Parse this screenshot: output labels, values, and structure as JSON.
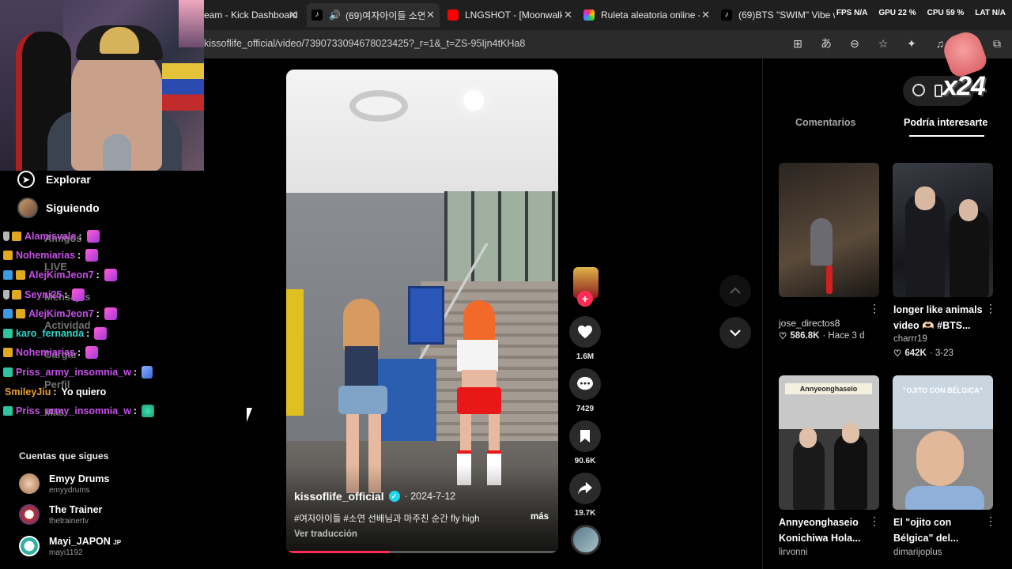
{
  "tabs": [
    {
      "label": "eam - Kick Dashboard",
      "icon": "kick-icon",
      "color": "#1f1f1f"
    },
    {
      "label": "(69)여자아이들 소연",
      "icon": "tiktok-icon",
      "active": true
    },
    {
      "label": "LNGSHOT - [Moonwalki",
      "icon": "youtube-icon",
      "color": "#ff0000"
    },
    {
      "label": "Ruleta aleatoria online -",
      "icon": "wheel-icon"
    },
    {
      "label": "(69)BTS \"SWIM\" Vibe w",
      "icon": "tiktok-icon"
    }
  ],
  "sysstats": [
    "FPS N/A",
    "GPU 22 %",
    "CPU 59 %",
    "LAT N/A"
  ],
  "address": {
    "url": "kissoflife_official/video/7390733094678023425?_r=1&_t=ZS-95Ijn4tKHa8"
  },
  "nav": {
    "explore": "Explorar",
    "following": "Siguiendo"
  },
  "ghost_nav": [
    "Amigos",
    "LIVE",
    "Mensajes",
    "Actividad",
    "Cargar",
    "Perfil",
    "Más"
  ],
  "chat": [
    {
      "badge": "shield-gold",
      "name": "Alamisvale",
      "color": "#c84fe8",
      "text": ""
    },
    {
      "badge": "gold",
      "name": "Nohemiarias",
      "color": "#c84fe8",
      "text": ""
    },
    {
      "badge": "blue",
      "name": "AlejKimJeon7",
      "color": "#c84fe8",
      "text": ""
    },
    {
      "badge": "shield-gold",
      "name": "Seyni25",
      "color": "#c84fe8",
      "text": ""
    },
    {
      "badge": "blue",
      "name": "AlejKimJeon7",
      "color": "#c84fe8",
      "text": ""
    },
    {
      "badge": "teal",
      "name": "karo_fernanda",
      "color": "#2fd6c8",
      "text": ""
    },
    {
      "badge": "gold",
      "name": "Nohemiarias",
      "color": "#c84fe8",
      "text": ""
    },
    {
      "badge": "teal",
      "name": "Priss_army_insomnia_w",
      "color": "#c84fe8",
      "text": ""
    },
    {
      "badge": "",
      "name": "SmileyJiu",
      "color": "#e8a02a",
      "text": "Yo quiero"
    },
    {
      "badge": "teal",
      "name": "Priss_army_insomnia_w",
      "color": "#c84fe8",
      "text": ""
    }
  ],
  "following_accounts": {
    "title": "Cuentas que sigues",
    "items": [
      {
        "name": "Emyy Drums",
        "handle": "emyydrums"
      },
      {
        "name": "The Trainer",
        "handle": "thetrainertv"
      },
      {
        "name": "Mayi_JAPON",
        "name_suffix": "JP",
        "handle": "mayi1192"
      }
    ]
  },
  "video": {
    "author": "kissoflife_official",
    "date": "· 2024-7-12",
    "caption": "#여자아이들 #소연 선배님과 마주친 순간 fly high",
    "more": "más",
    "translate": "Ver traducción",
    "progress": 0.38
  },
  "actions": {
    "likes": "1.6M",
    "comments": "7429",
    "saves": "90.6K",
    "shares": "19.7K"
  },
  "panel": {
    "tab_comments": "Comentarios",
    "tab_recommended": "Podría interesarte",
    "overlay_count": "x24"
  },
  "recommended": [
    {
      "title": "",
      "author": "jose_directos8",
      "likes": "586.8K",
      "time": "· Hace 3 d"
    },
    {
      "title": "longer like animals video 🫶🏻 #BTS...",
      "author": "charrr19",
      "likes": "642K",
      "time": "· 3-23"
    },
    {
      "title": "Annyeonghaseio Konichiwa Hola...",
      "author": "lirvonni",
      "overlay": "Annyeonghaseio",
      "likes": "",
      "time": ""
    },
    {
      "title": "El \"ojito con Bélgica\" del...",
      "author": "dimarijoplus",
      "overlay": "\"OJITO CON BÉLGICA\"",
      "likes": "",
      "time": ""
    }
  ],
  "colors": {
    "accent": "#fe2c55",
    "verified": "#20d5ec",
    "chat_purple": "#c84fe8"
  }
}
